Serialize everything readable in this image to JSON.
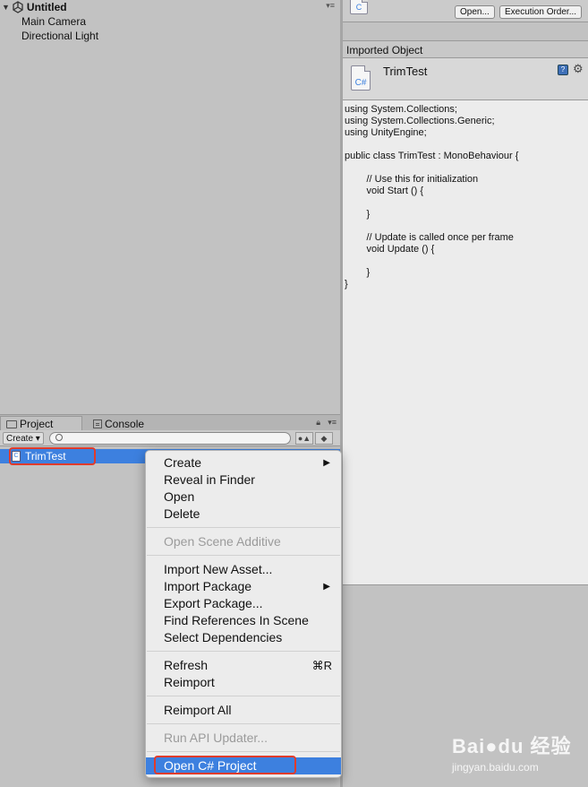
{
  "hierarchy": {
    "scene_title": "Untitled",
    "items": [
      "Main Camera",
      "Directional Light"
    ]
  },
  "project": {
    "tabs": [
      {
        "label": "Project",
        "icon": "folder-icon"
      },
      {
        "label": "Console",
        "icon": "console-icon"
      }
    ],
    "create_label": "Create ▾",
    "selected_asset": "TrimTest"
  },
  "inspector": {
    "open_btn": "Open...",
    "execution_order_btn": "Execution Order...",
    "section_title": "Imported Object",
    "asset_name": "TrimTest",
    "code_lines": [
      "using System.Collections;",
      "using System.Collections.Generic;",
      "using UnityEngine;",
      "",
      "public class TrimTest : MonoBehaviour {",
      "",
      "\t\t// Use this for initialization",
      "\t\tvoid Start () {",
      "",
      "\t\t}",
      "",
      "\t\t// Update is called once per frame",
      "\t\tvoid Update () {",
      "",
      "\t\t}",
      "}"
    ]
  },
  "context_menu": {
    "groups": [
      [
        {
          "label": "Create",
          "submenu": true
        },
        {
          "label": "Reveal in Finder"
        },
        {
          "label": "Open"
        },
        {
          "label": "Delete"
        }
      ],
      [
        {
          "label": "Open Scene Additive",
          "disabled": true
        }
      ],
      [
        {
          "label": "Import New Asset..."
        },
        {
          "label": "Import Package",
          "submenu": true
        },
        {
          "label": "Export Package..."
        },
        {
          "label": "Find References In Scene"
        },
        {
          "label": "Select Dependencies"
        }
      ],
      [
        {
          "label": "Refresh",
          "shortcut": "⌘R"
        },
        {
          "label": "Reimport"
        }
      ],
      [
        {
          "label": "Reimport All"
        }
      ],
      [
        {
          "label": "Run API Updater...",
          "disabled": true
        }
      ],
      [
        {
          "label": "Open C# Project",
          "selected": true
        }
      ]
    ]
  },
  "watermark": {
    "logo": "Bai●du 经验",
    "url": "jingyan.baidu.com"
  },
  "colors": {
    "selection": "#3d80df",
    "highlight_box": "#e03b2b",
    "panel_bg": "#c2c2c2",
    "menu_bg": "#ececec"
  }
}
